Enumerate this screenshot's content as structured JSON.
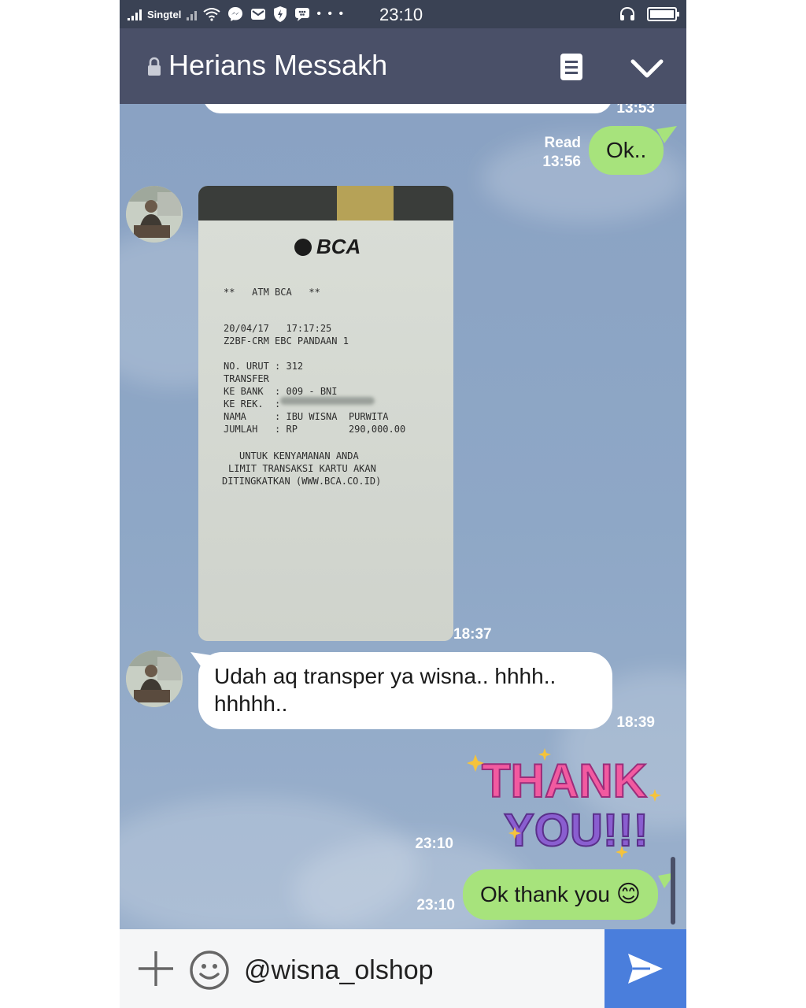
{
  "status_bar": {
    "carrier": "Singtel",
    "carrier_tag": "R",
    "time": "23:10",
    "icons": [
      "signal-icon",
      "wifi-icon",
      "messenger-icon",
      "mail-icon",
      "shield-icon",
      "bbm-icon",
      "more-icon",
      "headset-icon",
      "battery-icon"
    ],
    "more": "• • •"
  },
  "header": {
    "title": "Herians Messakh",
    "lock_icon": "lock-icon",
    "notes_icon": "notes-icon",
    "collapse_icon": "chevron-down-icon"
  },
  "messages": [
    {
      "id": "m0",
      "side": "in",
      "text": "",
      "time": "13:53"
    },
    {
      "id": "m1",
      "side": "out",
      "text": "Ok..",
      "status": "Read",
      "time": "13:56"
    },
    {
      "id": "m2",
      "side": "in",
      "type": "image",
      "time": "18:37",
      "receipt": {
        "bank_logo": "BCA",
        "lines": [
          "**   ATM BCA   **",
          "20/04/17   17:17:25",
          "Z2BF-CRM EBC PANDAAN 1",
          "NO. URUT : 312",
          "TRANSFER",
          "KE BANK  : 009 - BNI",
          "KE REK.  :",
          "NAMA     : IBU WISNA  PURWITA",
          "JUMLAH   : RP         290,000.00",
          "UNTUK KENYAMANAN ANDA",
          "LIMIT TRANSAKSI KARTU AKAN",
          "DITINGKATKAN (WWW.BCA.CO.ID)"
        ]
      }
    },
    {
      "id": "m3",
      "side": "in",
      "text": "Udah aq transper ya wisna.. hhhh.. hhhhh..",
      "time": "18:39"
    },
    {
      "id": "m4",
      "side": "out",
      "type": "sticker",
      "sticker_text": [
        "THANK",
        "YOU!!!"
      ],
      "time": "23:10"
    },
    {
      "id": "m5",
      "side": "out",
      "text": "Ok thank you",
      "emoji": "😊",
      "time": "23:10"
    }
  ],
  "input": {
    "value": "@wisna_olshop",
    "plus_icon": "plus-icon",
    "emoji_icon": "emoji-icon",
    "send_icon": "send-icon"
  },
  "colors": {
    "header": "#4a5068",
    "status_bar": "#3a4254",
    "chat_bg": "#8da4c4",
    "outgoing_bubble": "#a7e37c",
    "incoming_bubble": "#ffffff",
    "send_button": "#4a7edc"
  }
}
